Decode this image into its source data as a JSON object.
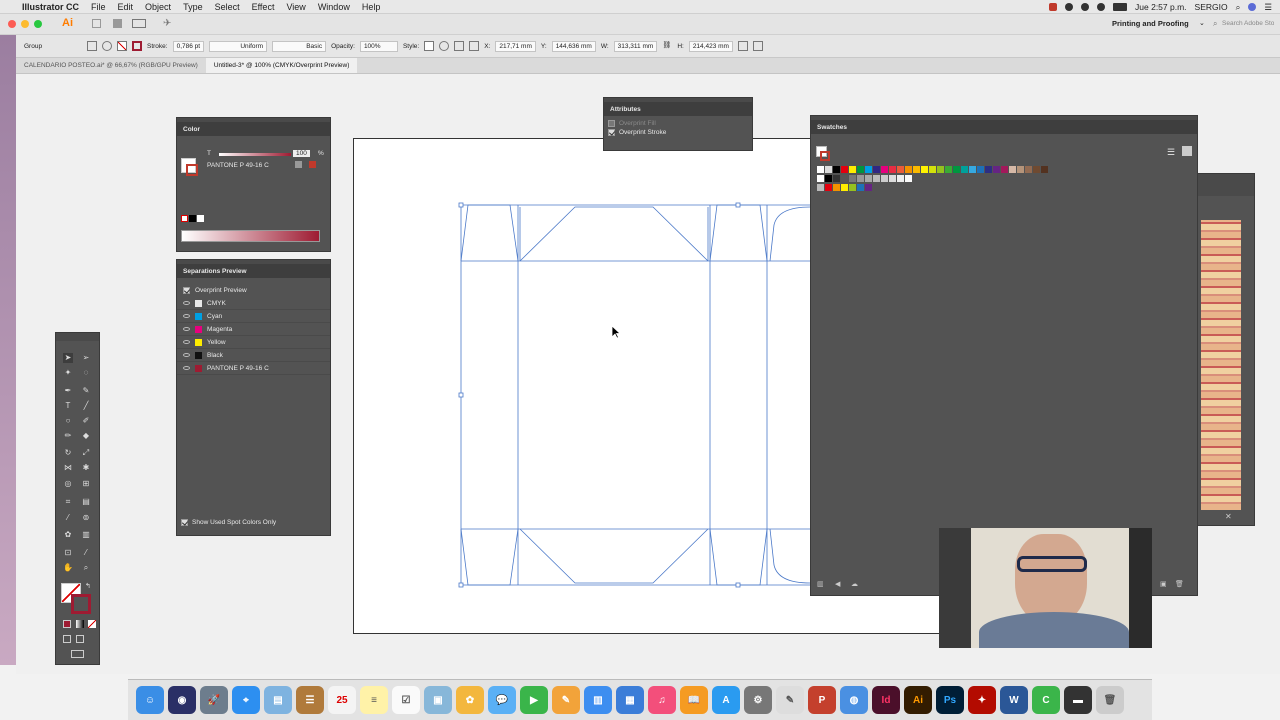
{
  "menubar": {
    "app_name": "Illustrator CC",
    "items": [
      "File",
      "Edit",
      "Object",
      "Type",
      "Select",
      "Effect",
      "View",
      "Window",
      "Help"
    ],
    "clock": "Jue 2:57 p.m.",
    "user": "SERGIO"
  },
  "appbar": {
    "workspace": "Printing and Proofing",
    "search_placeholder": "Search Adobe Stock"
  },
  "control": {
    "selection": "Group",
    "stroke_label": "Stroke:",
    "stroke_value": "0,786 pt",
    "stroke_profile": "Uniform",
    "brush": "Basic",
    "opacity_label": "Opacity:",
    "opacity_value": "100%",
    "style_label": "Style:",
    "x_label": "X:",
    "x_value": "217,71 mm",
    "y_label": "Y:",
    "y_value": "144,636 mm",
    "w_label": "W:",
    "w_value": "313,311 mm",
    "h_label": "H:",
    "h_value": "214,423 mm"
  },
  "tabs": [
    {
      "label": "CALENDARIO POSTEO.ai* @ 66,67% (RGB/GPU Preview)"
    },
    {
      "label": "Untitled-3* @ 100% (CMYK/Overprint Preview)"
    }
  ],
  "color_panel": {
    "title": "Color",
    "tint_label": "T",
    "tint_value": "100",
    "tint_unit": "%",
    "swatch_name": "PANTONE P 49-16 C"
  },
  "attributes_panel": {
    "title": "Attributes",
    "overprint_fill": "Overprint Fill",
    "overprint_stroke": "Overprint Stroke"
  },
  "separations_panel": {
    "title": "Separations Preview",
    "overprint_preview": "Overprint Preview",
    "rows": [
      {
        "name": "CMYK",
        "color": "#e8e8e8"
      },
      {
        "name": "Cyan",
        "color": "#00a0e3"
      },
      {
        "name": "Magenta",
        "color": "#e6007e"
      },
      {
        "name": "Yellow",
        "color": "#ffed00"
      },
      {
        "name": "Black",
        "color": "#111111"
      },
      {
        "name": "PANTONE P 49-16 C",
        "color": "#9e1b32"
      }
    ],
    "show_spot": "Show Used Spot Colors Only"
  },
  "swatches_panel": {
    "title": "Swatches"
  },
  "colors": {
    "accent": "#9e1b32"
  }
}
